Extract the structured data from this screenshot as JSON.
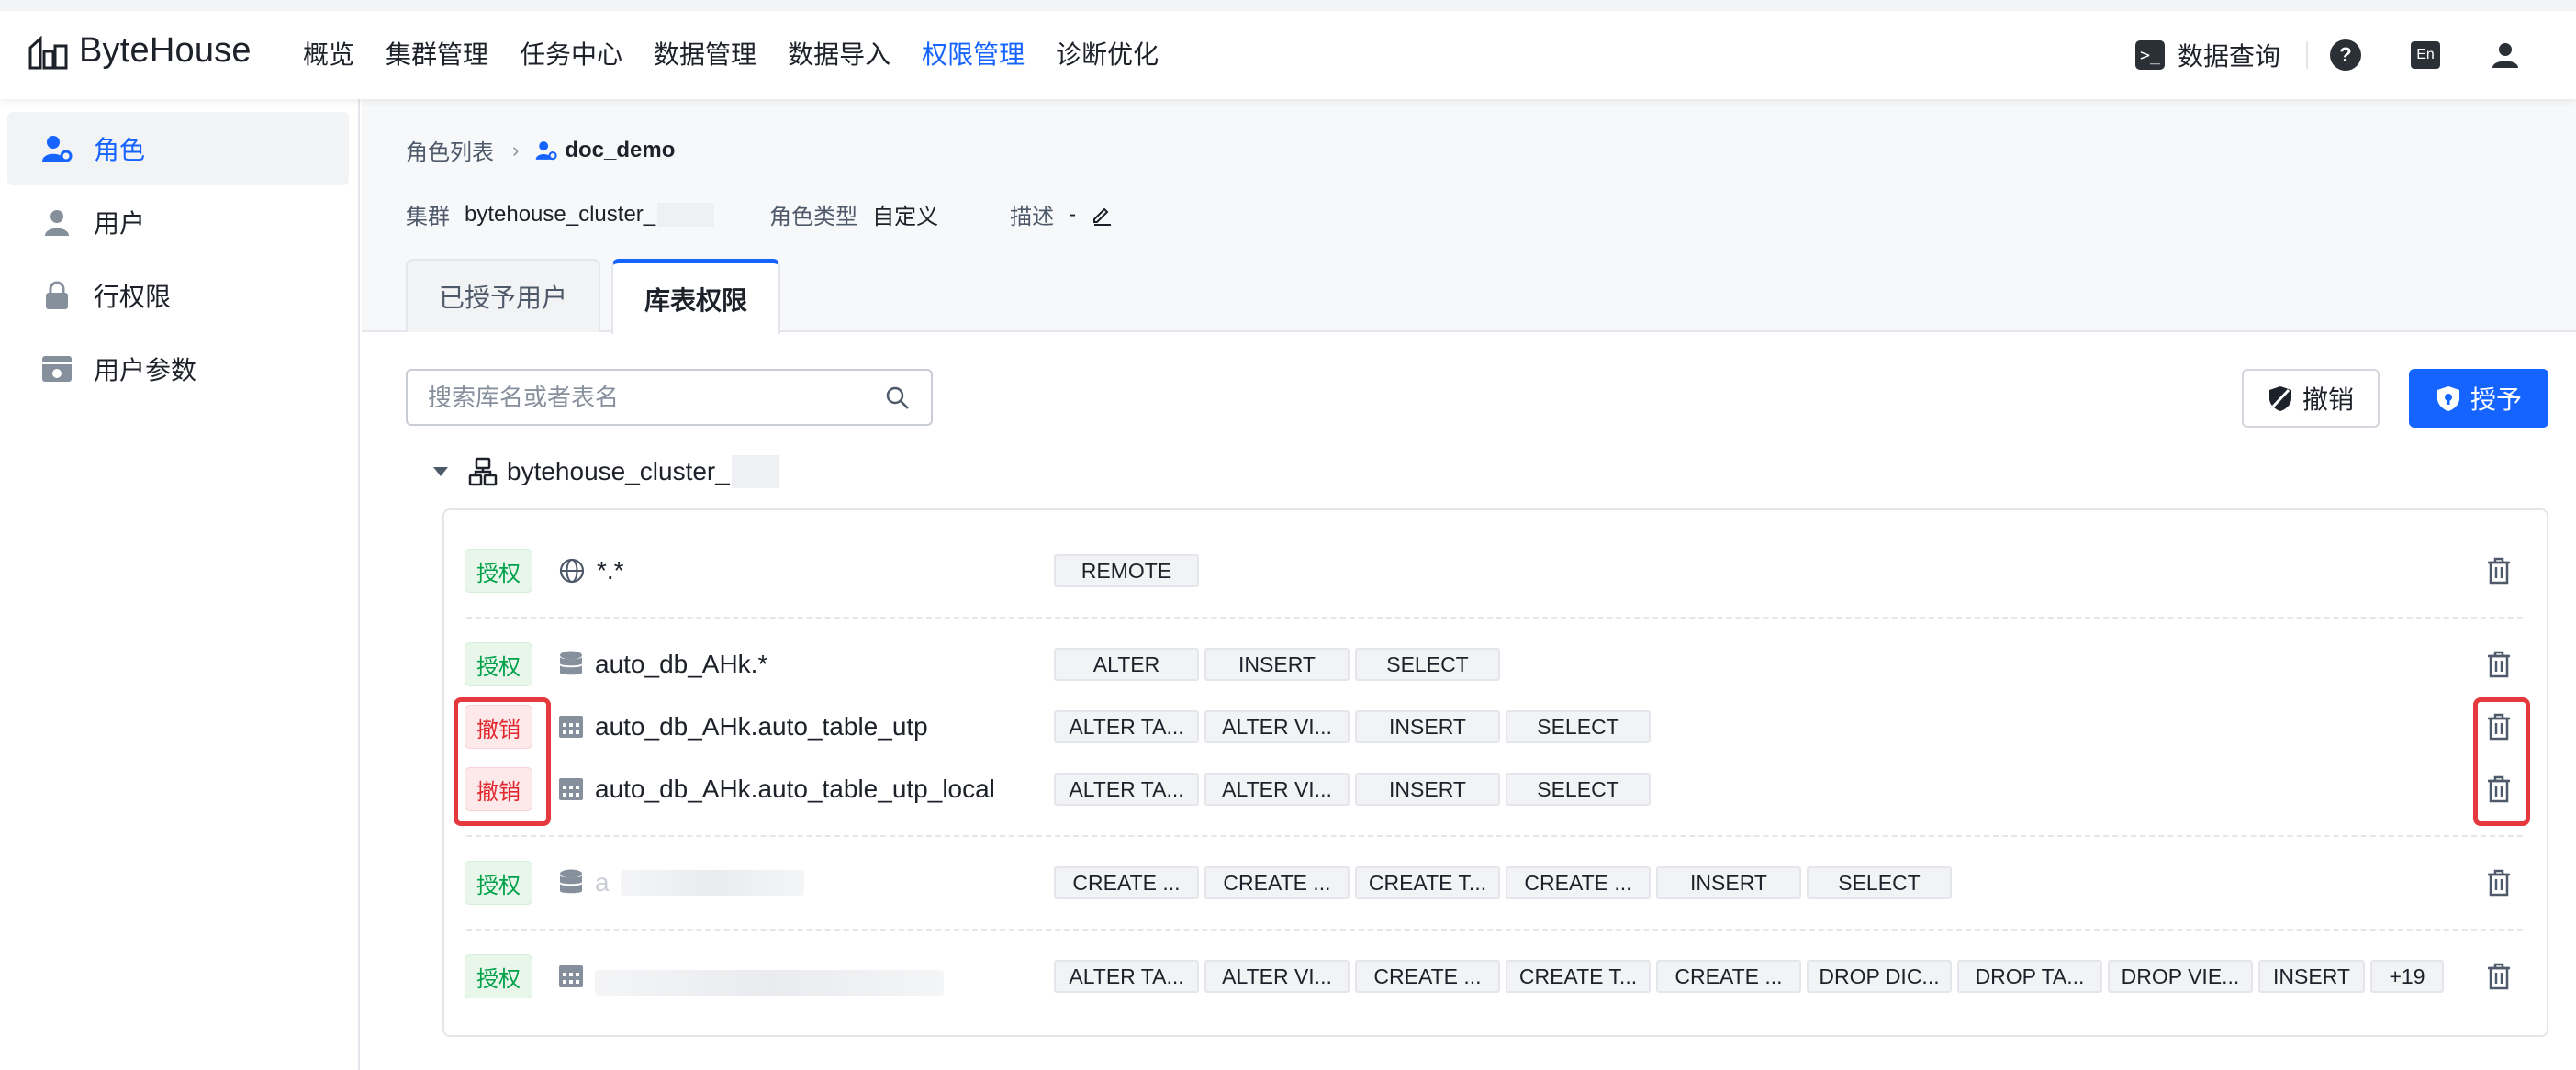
{
  "app": {
    "logo_text": "ByteHouse"
  },
  "nav": {
    "items": [
      "概览",
      "集群管理",
      "任务中心",
      "数据管理",
      "数据导入",
      "权限管理",
      "诊断优化"
    ],
    "active_index": 5,
    "query_label": "数据查询",
    "help_icon": "help-icon",
    "lang_label": "En",
    "user_icon": "user-icon"
  },
  "sidebar": {
    "items": [
      {
        "label": "角色",
        "icon": "role-icon",
        "active": true
      },
      {
        "label": "用户",
        "icon": "user-icon",
        "active": false
      },
      {
        "label": "行权限",
        "icon": "lock-icon",
        "active": false
      },
      {
        "label": "用户参数",
        "icon": "settings-card-icon",
        "active": false
      }
    ]
  },
  "breadcrumb": {
    "parent": "角色列表",
    "current": "doc_demo"
  },
  "meta": {
    "cluster_label": "集群",
    "cluster_value": "bytehouse_cluster_",
    "role_type_label": "角色类型",
    "role_type_value": "自定义",
    "desc_label": "描述",
    "desc_value": "-"
  },
  "tabs": [
    {
      "label": "已授予用户",
      "active": false
    },
    {
      "label": "库表权限",
      "active": true
    }
  ],
  "search": {
    "placeholder": "搜索库名或者表名",
    "value": ""
  },
  "actions": {
    "revoke_label": "撤销",
    "grant_label": "授予"
  },
  "tree": {
    "node_label": "bytehouse_cluster_",
    "expanded": true
  },
  "permissions": [
    {
      "badge": "授权",
      "status": "grant",
      "icon": "globe-icon",
      "object": "*.*",
      "privileges": [
        "REMOTE"
      ]
    },
    {
      "badge": "授权",
      "status": "grant",
      "icon": "database-icon",
      "object": "auto_db_AHk.*",
      "privileges": [
        "ALTER",
        "INSERT",
        "SELECT"
      ]
    },
    {
      "badge": "撤销",
      "status": "revoke",
      "icon": "table-icon",
      "object": "auto_db_AHk.auto_table_utp",
      "privileges": [
        "ALTER TA...",
        "ALTER VI...",
        "INSERT",
        "SELECT"
      ]
    },
    {
      "badge": "撤销",
      "status": "revoke",
      "icon": "table-icon",
      "object": "auto_db_AHk.auto_table_utp_local",
      "privileges": [
        "ALTER TA...",
        "ALTER VI...",
        "INSERT",
        "SELECT"
      ]
    },
    {
      "badge": "授权",
      "status": "grant",
      "icon": "database-icon",
      "object": "a",
      "privileges": [
        "CREATE ...",
        "CREATE ...",
        "CREATE T...",
        "CREATE ...",
        "INSERT",
        "SELECT"
      ]
    },
    {
      "badge": "授权",
      "status": "grant",
      "icon": "table-icon",
      "object": "",
      "privileges": [
        "ALTER TA...",
        "ALTER VI...",
        "CREATE ...",
        "CREATE T...",
        "CREATE ...",
        "DROP DIC...",
        "DROP TA...",
        "DROP VIE...",
        "INSERT"
      ],
      "more": "+19"
    }
  ],
  "colors": {
    "primary": "#1664ff",
    "grant": "#00a14a",
    "revoke": "#e0282e",
    "highlight": "#e5393e"
  }
}
